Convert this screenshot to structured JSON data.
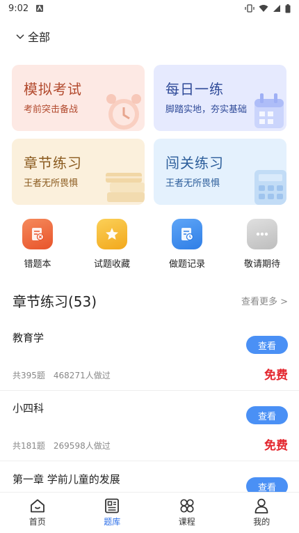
{
  "status_bar": {
    "time": "9:02"
  },
  "scope": {
    "label": "全部"
  },
  "cards": [
    {
      "title": "模拟考试",
      "subtitle": "考前突击备战"
    },
    {
      "title": "每日一练",
      "subtitle": "脚踏实地，夯实基础"
    },
    {
      "title": "章节练习",
      "subtitle": "王者无所畏惧"
    },
    {
      "title": "闯关练习",
      "subtitle": "王者无所畏惧"
    }
  ],
  "quick_actions": [
    {
      "label": "错题本",
      "icon": "error-book-icon",
      "color": "#ef6a3a"
    },
    {
      "label": "试题收藏",
      "icon": "star-icon",
      "color": "#f5b52b"
    },
    {
      "label": "做题记录",
      "icon": "record-icon",
      "color": "#3d8ef0"
    },
    {
      "label": "敬请期待",
      "icon": "more-icon",
      "color": "#c9c9c9"
    }
  ],
  "section": {
    "title": "章节练习(53)",
    "more": "查看更多 >"
  },
  "items": [
    {
      "name": "教育学",
      "count": "共395题",
      "done": "468271人做过",
      "button": "查看",
      "price": "免费"
    },
    {
      "name": "小四科",
      "count": "共181题",
      "done": "269598人做过",
      "button": "查看",
      "price": "免费"
    },
    {
      "name": "第一章 学前儿童的发展",
      "button": "查看"
    }
  ],
  "tabs": [
    {
      "label": "首页",
      "icon": "home-icon"
    },
    {
      "label": "题库",
      "icon": "question-bank-icon",
      "active": true
    },
    {
      "label": "课程",
      "icon": "course-icon"
    },
    {
      "label": "我的",
      "icon": "profile-icon"
    }
  ]
}
